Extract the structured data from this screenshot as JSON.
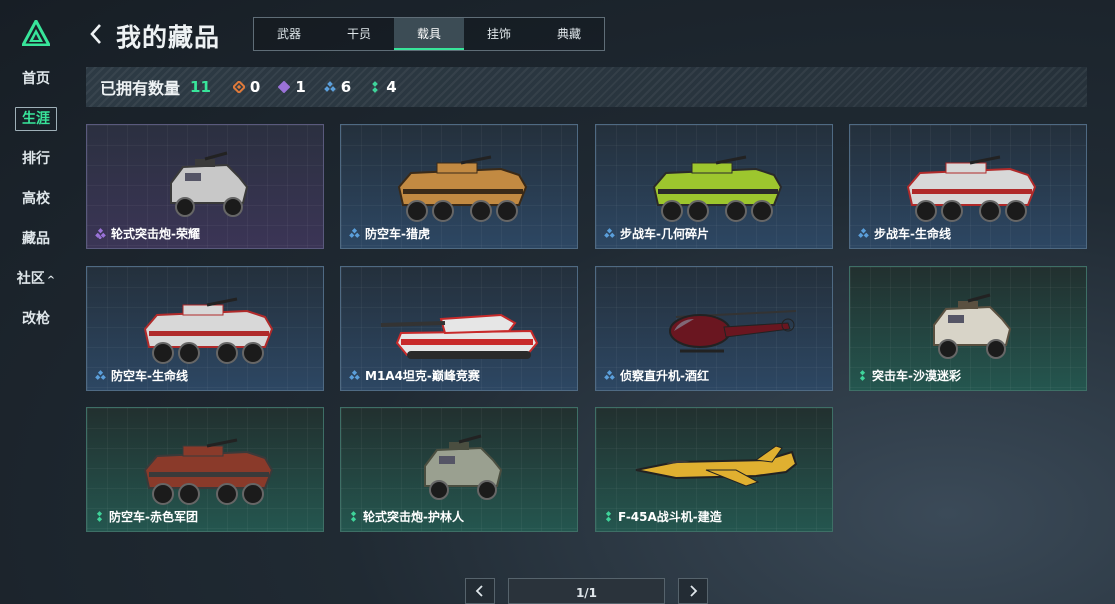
{
  "sidebar": {
    "items": [
      {
        "label": "首页"
      },
      {
        "label": "生涯"
      },
      {
        "label": "排行"
      },
      {
        "label": "高校"
      },
      {
        "label": "藏品"
      },
      {
        "label": "社区",
        "chevron": "^"
      },
      {
        "label": "改枪"
      }
    ],
    "active_index": 1,
    "accent": "#38e59a"
  },
  "header": {
    "title": "我的藏品",
    "tabs": [
      "武器",
      "干员",
      "载具",
      "挂饰",
      "典藏"
    ],
    "active_tab": 2
  },
  "stats": {
    "owned_label": "已拥有数量",
    "owned_count": "11",
    "rarities": [
      {
        "tier": "orange",
        "color": "#e07a3a",
        "count": "0"
      },
      {
        "tier": "purple",
        "color": "#9a72d8",
        "count": "1"
      },
      {
        "tier": "blue",
        "color": "#5b9fdb",
        "count": "6"
      },
      {
        "tier": "green",
        "color": "#3fd39a",
        "count": "4"
      }
    ]
  },
  "items": [
    {
      "name": "轮式突击炮-荣耀",
      "rarity": "purple",
      "icon": "armored-car-icon"
    },
    {
      "name": "防空车-猎虎",
      "rarity": "blue",
      "icon": "apc-icon"
    },
    {
      "name": "步战车-几何碎片",
      "rarity": "blue",
      "icon": "apc-icon"
    },
    {
      "name": "步战车-生命线",
      "rarity": "blue",
      "icon": "apc-icon"
    },
    {
      "name": "防空车-生命线",
      "rarity": "blue",
      "icon": "apc-icon"
    },
    {
      "name": "M1A4坦克-巅峰竞赛",
      "rarity": "blue",
      "icon": "tank-icon"
    },
    {
      "name": "侦察直升机-酒红",
      "rarity": "blue",
      "icon": "helicopter-icon"
    },
    {
      "name": "突击车-沙漠迷彩",
      "rarity": "green",
      "icon": "armored-car-icon"
    },
    {
      "name": "防空车-赤色军团",
      "rarity": "green",
      "icon": "apc-icon"
    },
    {
      "name": "轮式突击炮-护林人",
      "rarity": "green",
      "icon": "armored-car-icon"
    },
    {
      "name": "F-45A战斗机-建造",
      "rarity": "green",
      "icon": "jet-icon"
    }
  ],
  "pager": {
    "text": "1/1"
  }
}
